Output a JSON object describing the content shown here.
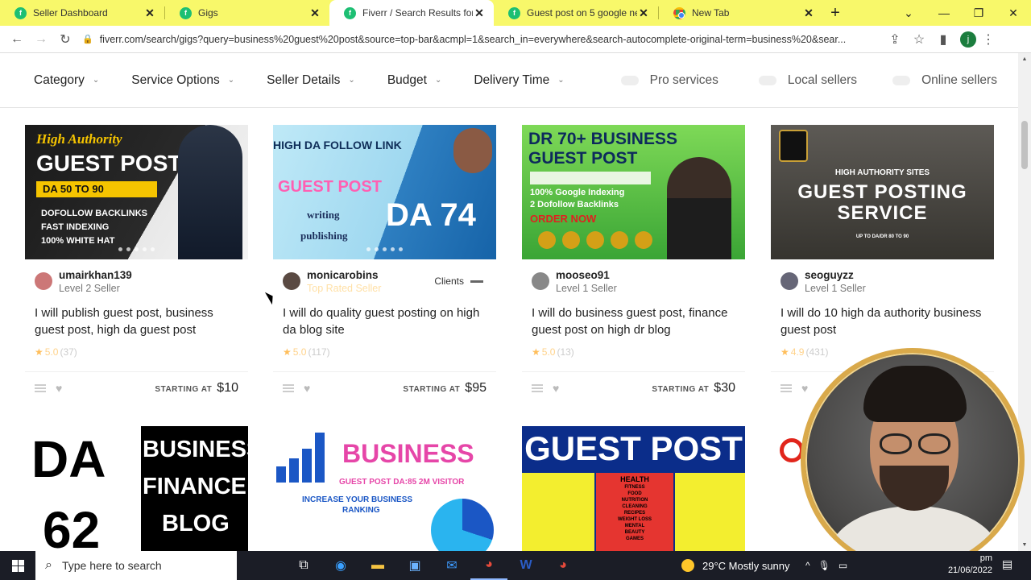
{
  "tabs": [
    {
      "title": "Seller Dashboard",
      "icon": "fiverr-favicon-icon"
    },
    {
      "title": "Gigs",
      "icon": "fiverr-favicon-icon"
    },
    {
      "title": "Fiverr / Search Results for 'b",
      "icon": "fiverr-favicon-icon",
      "active": true
    },
    {
      "title": "Guest post on 5 google new",
      "icon": "fiverr-favicon-icon"
    },
    {
      "title": "New Tab",
      "icon": "chrome-icon"
    }
  ],
  "address": {
    "url": "fiverr.com/search/gigs?query=business%20guest%20post&source=top-bar&acmpl=1&search_in=everywhere&search-autocomplete-original-term=business%20&sear..."
  },
  "profile_initial": "j",
  "filters": [
    {
      "label": "Category"
    },
    {
      "label": "Service Options"
    },
    {
      "label": "Seller Details"
    },
    {
      "label": "Budget"
    },
    {
      "label": "Delivery Time"
    }
  ],
  "toggles": [
    {
      "label": "Pro services"
    },
    {
      "label": "Local sellers"
    },
    {
      "label": "Online sellers"
    }
  ],
  "gigs": [
    {
      "seller": "umairkhan139",
      "level": "Level 2 Seller",
      "title": "I will publish guest post, business guest post, high da guest post",
      "rating": "5.0",
      "count": "(37)",
      "price_label": "STARTING AT",
      "price": "$10",
      "thumb": {
        "l1": "High Authority",
        "l2": "GUEST POST",
        "l3": "DA 50 TO 90",
        "b1": "DOFOLLOW BACKLINKS",
        "b2": "FAST INDEXING",
        "b3": "100% WHITE HAT"
      }
    },
    {
      "seller": "monicarobins",
      "level": "Top Rated Seller",
      "clients": "Clients",
      "title": "I will do quality guest posting on high da blog site",
      "rating": "5.0",
      "count": "(117)",
      "price_label": "STARTING AT",
      "price": "$95",
      "thumb": {
        "l1": "HIGH DA FOLLOW LINK",
        "l2": "GUEST POST",
        "l3": "writing",
        "l4": "publishing",
        "l5": "DA 74"
      }
    },
    {
      "seller": "mooseo91",
      "level": "Level 1 Seller",
      "title": "I will do business guest post, finance guest post on high dr blog",
      "rating": "5.0",
      "count": "(13)",
      "price_label": "STARTING AT",
      "price": "$30",
      "thumb": {
        "l1": "DR 70+ BUSINESS",
        "l2": "GUEST POST",
        "b1": "100% Google Indexing",
        "b2": "2 Dofollow Backlinks",
        "b3": "ORDER NOW"
      }
    },
    {
      "seller": "seoguyzz",
      "level": "Level 1 Seller",
      "title": "I will do 10 high da authority business guest post",
      "rating": "4.9",
      "count": "(431)",
      "thumb": {
        "l1": "HIGH AUTHORITY SITES",
        "l2": "GUEST POSTING",
        "l3": "SERVICE",
        "l4": "UP TO DA/DR 80 TO 90"
      }
    }
  ],
  "row2": [
    {
      "l1": "DA",
      "l2": "62",
      "r1": "BUSINESS",
      "r2": "FINANCE",
      "r3": "BLOG"
    },
    {
      "l1": "BUSINESS",
      "l2": "GUEST POST DA:85 2M VISITOR",
      "l3": "INCREASE YOUR BUSINESS",
      "l4": "RANKING"
    },
    {
      "l1": "GUEST POST",
      "l2": "HEALTH",
      "items": [
        "FITNESS",
        "FOOD",
        "NUTRITION",
        "CLEANING",
        "RECIPES",
        "WEIGHT LOSS",
        "MENTAL",
        "BEAUTY",
        "GAMES"
      ]
    }
  ],
  "taskbar": {
    "search_placeholder": "Type here to search",
    "weather": "29°C  Mostly sunny",
    "time": "pm",
    "date": "21/06/2022"
  },
  "colors": {
    "tabstrip": "#f8f86a",
    "fiverr_green": "#1dbf73",
    "taskbar": "#1b1d26"
  }
}
